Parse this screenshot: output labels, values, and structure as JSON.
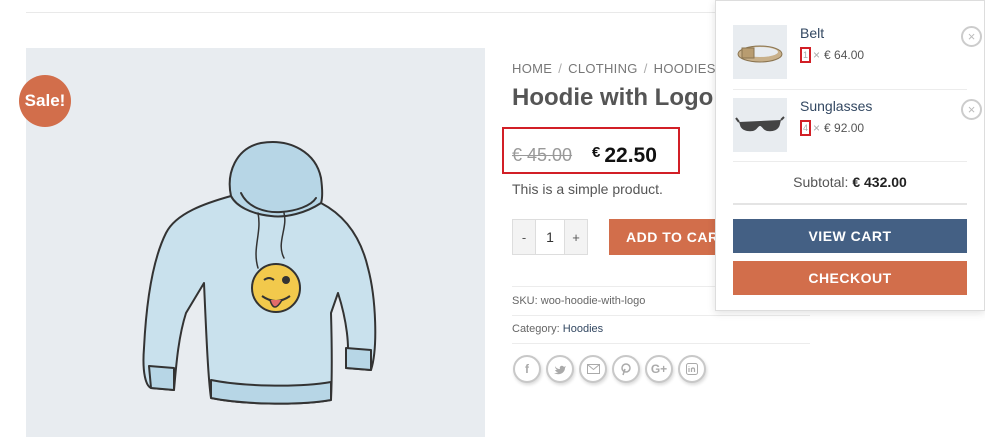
{
  "sale_badge": "Sale!",
  "breadcrumb": [
    "HOME",
    "CLOTHING",
    "HOODIES"
  ],
  "breadcrumb_sep": "/",
  "product": {
    "title": "Hoodie with Logo",
    "old_price": "€ 45.00",
    "currency": "€",
    "new_price": "22.50",
    "short_description": "This is a simple product.",
    "quantity": "1",
    "qty_minus": "-",
    "qty_plus": "+",
    "add_to_cart": "ADD TO CART",
    "sku_label": "SKU:",
    "sku": "woo-hoodie-with-logo",
    "category_label": "Category:",
    "category": "Hoodies"
  },
  "share_icons": [
    "facebook-icon",
    "twitter-icon",
    "email-icon",
    "pinterest-icon",
    "google-plus-icon",
    "linkedin-icon"
  ],
  "mini_cart": {
    "items": [
      {
        "name": "Belt",
        "qty": "1",
        "times": "×",
        "price": "€ 64.00"
      },
      {
        "name": "Sunglasses",
        "qty": "4",
        "times": "×",
        "price": "€ 92.00"
      }
    ],
    "subtotal_label": "Subtotal:",
    "subtotal_value": "€ 432.00",
    "view_cart": "VIEW CART",
    "checkout": "CHECKOUT",
    "remove_symbol": "×"
  },
  "colors": {
    "accent": "#d26e4b",
    "primary": "#446084",
    "highlight_box": "#d21f26"
  }
}
